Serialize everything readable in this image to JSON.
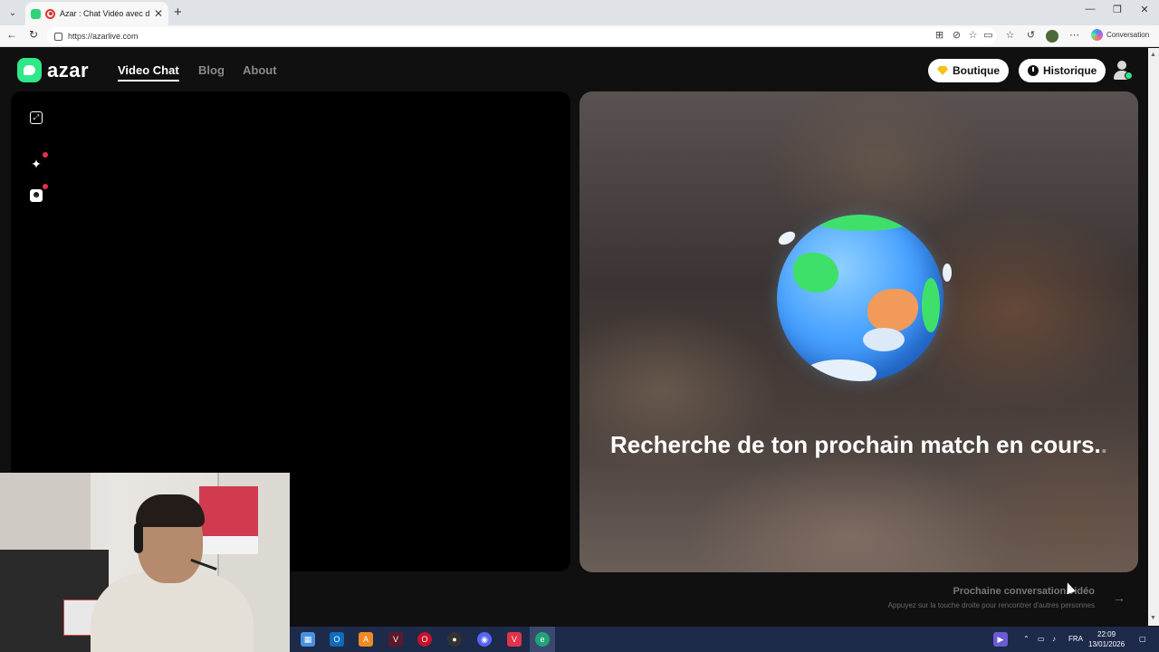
{
  "browser": {
    "tab_title": "Azar : Chat Vidéo avec de no",
    "url": "https://azarlive.com",
    "copilot_label": "Conversation"
  },
  "nav": {
    "logo_text": "azar",
    "links": [
      "Video Chat",
      "Blog",
      "About"
    ],
    "boutique_label": "Boutique",
    "historique_label": "Historique"
  },
  "main": {
    "search_text": "Recherche de ton prochain match en cours.",
    "search_text_dot": ".",
    "next_title": "Prochaine conversation vidéo",
    "next_subtitle": "Appuyez sur la touche droite pour rencontrer d'autres personnes"
  },
  "taskbar": {
    "language": "FRA",
    "time": "22:09",
    "date": "13/01/2026"
  },
  "colors": {
    "brand_green": "#2ee88a",
    "notif_red": "#e0344a",
    "gem_yellow": "#f4c21b"
  }
}
